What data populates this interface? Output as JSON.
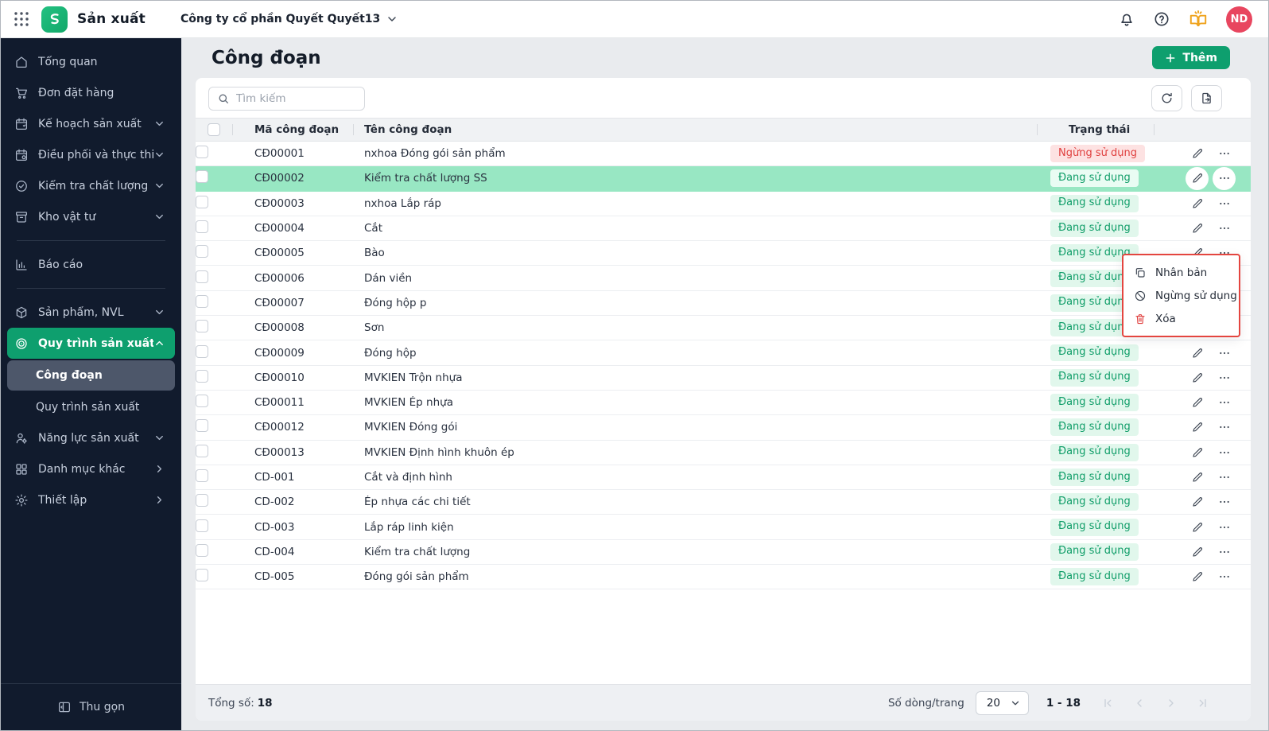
{
  "colors": {
    "primary_green": "#0e9f6e",
    "sidebar_bg": "#111b2d",
    "row_highlight": "#98e7c3",
    "status_active_text": "#0f9d68",
    "status_inactive_text": "#e0403f",
    "menu_border_red": "#e4453f",
    "avatar_bg": "#e8465f"
  },
  "topbar": {
    "app_title": "Sản xuất",
    "company_selector": "Công ty cổ phần Quyết Quyết13",
    "avatar_initials": "ND"
  },
  "sidebar": {
    "items": [
      {
        "label": "Tổng quan",
        "icon": "home-icon"
      },
      {
        "label": "Đơn đặt hàng",
        "icon": "cart-icon"
      },
      {
        "label": "Kế hoạch sản xuất",
        "icon": "calendar-plan-icon",
        "chevron": "down"
      },
      {
        "label": "Điều phối và thực thi",
        "icon": "calendar-execute-icon",
        "chevron": "down"
      },
      {
        "label": "Kiểm tra chất lượng",
        "icon": "quality-check-icon",
        "chevron": "down"
      },
      {
        "label": "Kho vật tư",
        "icon": "warehouse-icon",
        "chevron": "down",
        "divider_after": true
      },
      {
        "label": "Báo cáo",
        "icon": "report-chart-icon",
        "divider_after": true
      },
      {
        "label": "Sản phẩm, NVL",
        "icon": "cube-icon",
        "chevron": "down"
      },
      {
        "label": "Quy trình sản xuất",
        "icon": "process-spiral-icon",
        "chevron": "up",
        "active": true,
        "children": [
          {
            "label": "Công đoạn",
            "active": true
          },
          {
            "label": "Quy trình sản xuất"
          }
        ]
      },
      {
        "label": "Năng lực sản xuất",
        "icon": "capacity-icon",
        "chevron": "down"
      },
      {
        "label": "Danh mục khác",
        "icon": "categories-icon",
        "chevron": "right"
      },
      {
        "label": "Thiết lập",
        "icon": "settings-gear-icon",
        "chevron": "right"
      }
    ],
    "collapse_label": "Thu gọn"
  },
  "page": {
    "title": "Công đoạn",
    "add_button_label": "Thêm"
  },
  "toolbar": {
    "search_placeholder": "Tìm kiếm"
  },
  "table": {
    "columns": [
      "Mã công đoạn",
      "Tên công đoạn",
      "Trạng thái"
    ],
    "status_labels": {
      "active": "Đang sử dụng",
      "inactive": "Ngừng sử dụng"
    },
    "rows": [
      {
        "code": "CĐ00001",
        "name": "nxhoa Đóng gói sản phẩm",
        "status": "inactive"
      },
      {
        "code": "CĐ00002",
        "name": "Kiểm tra chất lượng SS",
        "status": "active",
        "highlighted": true
      },
      {
        "code": "CĐ00003",
        "name": "nxhoa Lắp ráp",
        "status": "active"
      },
      {
        "code": "CĐ00004",
        "name": "Cắt",
        "status": "active"
      },
      {
        "code": "CĐ00005",
        "name": "Bào",
        "status": "active"
      },
      {
        "code": "CĐ00006",
        "name": "Dán viền",
        "status": "active"
      },
      {
        "code": "CĐ00007",
        "name": "Đóng hộp p",
        "status": "active"
      },
      {
        "code": "CĐ00008",
        "name": "Sơn",
        "status": "active"
      },
      {
        "code": "CĐ00009",
        "name": "Đóng hộp",
        "status": "active"
      },
      {
        "code": "CĐ00010",
        "name": "MVKIEN Trộn nhựa",
        "status": "active"
      },
      {
        "code": "CĐ00011",
        "name": "MVKIEN Ép nhựa",
        "status": "active"
      },
      {
        "code": "CĐ00012",
        "name": "MVKIEN Đóng gói",
        "status": "active"
      },
      {
        "code": "CĐ00013",
        "name": "MVKIEN Định hình khuôn ép",
        "status": "active"
      },
      {
        "code": "CD-001",
        "name": "Cắt và định hình",
        "status": "active"
      },
      {
        "code": "CD-002",
        "name": "Ép nhựa các chi tiết",
        "status": "active"
      },
      {
        "code": "CD-003",
        "name": "Lắp ráp linh kiện",
        "status": "active"
      },
      {
        "code": "CD-004",
        "name": "Kiểm tra chất lượng",
        "status": "active"
      },
      {
        "code": "CD-005",
        "name": "Đóng gói sản phẩm",
        "status": "active"
      }
    ]
  },
  "context_menu": {
    "items": [
      {
        "label": "Nhân bản",
        "icon": "duplicate-icon"
      },
      {
        "label": "Ngừng sử dụng",
        "icon": "deactivate-icon"
      },
      {
        "label": "Xóa",
        "icon": "delete-icon",
        "danger": true
      }
    ]
  },
  "footer": {
    "total_label": "Tổng số:",
    "total_value": "18",
    "rows_per_page_label": "Số dòng/trang",
    "page_size_value": "20",
    "range": "1 - 18"
  }
}
